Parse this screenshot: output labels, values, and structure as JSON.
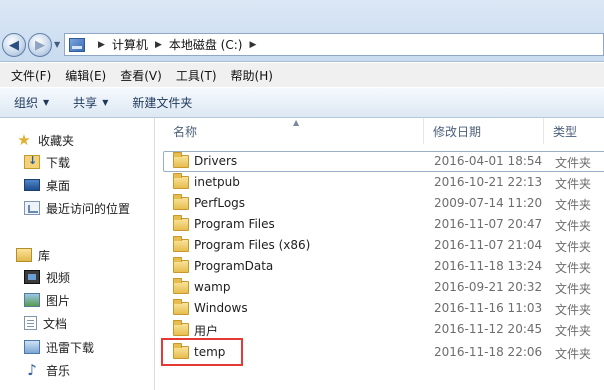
{
  "address": {
    "crumbs": [
      "计算机",
      "本地磁盘 (C:)"
    ]
  },
  "menu": [
    "文件(F)",
    "编辑(E)",
    "查看(V)",
    "工具(T)",
    "帮助(H)"
  ],
  "commands": {
    "organize": "组织",
    "share": "共享",
    "new_folder": "新建文件夹"
  },
  "sidebar": {
    "favorites": {
      "label": "收藏夹",
      "items": [
        "下载",
        "桌面",
        "最近访问的位置"
      ]
    },
    "library": {
      "label": "库",
      "items": [
        "视频",
        "图片",
        "文档",
        "迅雷下载",
        "音乐"
      ]
    }
  },
  "columns": {
    "name": "名称",
    "modified": "修改日期",
    "type": "类型"
  },
  "files": [
    {
      "name": "Drivers",
      "date": "2016-04-01 18:54",
      "type": "文件夹"
    },
    {
      "name": "inetpub",
      "date": "2016-10-21 22:13",
      "type": "文件夹"
    },
    {
      "name": "PerfLogs",
      "date": "2009-07-14 11:20",
      "type": "文件夹"
    },
    {
      "name": "Program Files",
      "date": "2016-11-07 20:47",
      "type": "文件夹"
    },
    {
      "name": "Program Files (x86)",
      "date": "2016-11-07 21:04",
      "type": "文件夹"
    },
    {
      "name": "ProgramData",
      "date": "2016-11-18 13:24",
      "type": "文件夹"
    },
    {
      "name": "wamp",
      "date": "2016-09-21 20:32",
      "type": "文件夹"
    },
    {
      "name": "Windows",
      "date": "2016-11-16 11:03",
      "type": "文件夹"
    },
    {
      "name": "用户",
      "date": "2016-11-12 20:45",
      "type": "文件夹"
    },
    {
      "name": "temp",
      "date": "2016-11-18 22:06",
      "type": "文件夹"
    }
  ],
  "colors": {
    "highlight_box": "#e53935",
    "folder": "#e7bd4f"
  }
}
